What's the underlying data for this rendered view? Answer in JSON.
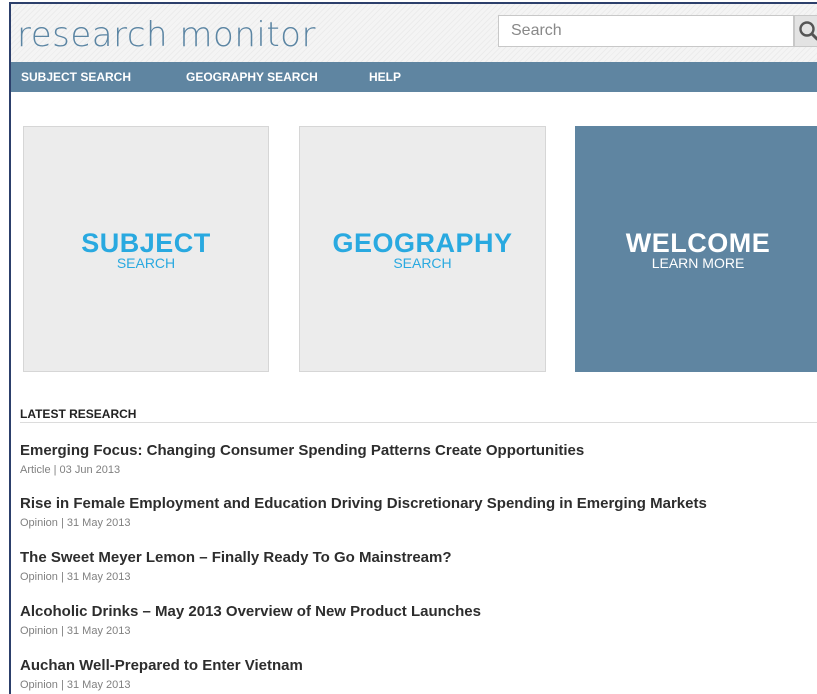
{
  "header": {
    "logo": "research monitor",
    "search_placeholder": "Search"
  },
  "nav": {
    "items": [
      {
        "label": "SUBJECT SEARCH"
      },
      {
        "label": "GEOGRAPHY SEARCH"
      },
      {
        "label": "HELP"
      }
    ]
  },
  "tiles": [
    {
      "title": "SUBJECT",
      "subtitle": "SEARCH"
    },
    {
      "title": "GEOGRAPHY",
      "subtitle": "SEARCH"
    },
    {
      "title": "WELCOME",
      "subtitle": "LEARN MORE"
    }
  ],
  "latest": {
    "heading": "LATEST RESEARCH",
    "articles": [
      {
        "title": "Emerging Focus: Changing Consumer Spending Patterns Create Opportunities",
        "type": "Article",
        "date": "03 Jun 2013",
        "meta": "Article | 03 Jun 2013"
      },
      {
        "title": "Rise in Female Employment and Education Driving Discretionary Spending in Emerging Markets",
        "type": "Opinion",
        "date": "31 May 2013",
        "meta": "Opinion | 31 May 2013"
      },
      {
        "title": "The Sweet Meyer Lemon – Finally Ready To Go Mainstream?",
        "type": "Opinion",
        "date": "31 May 2013",
        "meta": "Opinion | 31 May 2013"
      },
      {
        "title": "Alcoholic Drinks – May 2013 Overview of New Product Launches",
        "type": "Opinion",
        "date": "31 May 2013",
        "meta": "Opinion | 31 May 2013"
      },
      {
        "title": "Auchan Well-Prepared to Enter Vietnam",
        "type": "Opinion",
        "date": "31 May 2013",
        "meta": "Opinion | 31 May 2013"
      }
    ]
  },
  "colors": {
    "brand_blue": "#5f85a1",
    "tile_accent": "#29a9e0",
    "tile_background": "#ececec"
  },
  "icons": {
    "search": "search-icon"
  }
}
